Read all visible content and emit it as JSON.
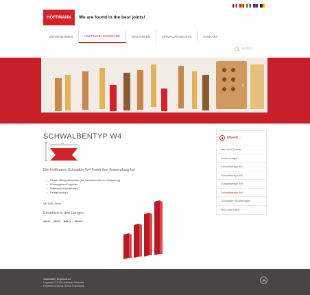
{
  "header": {
    "logo_text": "HOFFMANN",
    "tagline": "We are found in the best joints!",
    "flags": [
      {
        "name": "flag-fr",
        "colors": [
          "#1f3d9a",
          "#ffffff",
          "#d2232a"
        ]
      },
      {
        "name": "flag-es",
        "colors": [
          "#c8102e",
          "#f2c200",
          "#c8102e"
        ]
      },
      {
        "name": "flag-it",
        "colors": [
          "#1e8a3a",
          "#ffffff",
          "#d2232a"
        ]
      },
      {
        "name": "flag-gb",
        "colors": [
          "#1f3d9a",
          "#d2232a",
          "#1f3d9a"
        ]
      },
      {
        "name": "flag-de",
        "colors": [
          "#111111",
          "#d2232a",
          "#f2c200"
        ]
      }
    ]
  },
  "nav": {
    "items": [
      {
        "label": "UNTERNEHMEN",
        "active": false
      },
      {
        "label": "HOFFMANN SCHWALBE",
        "active": true
      },
      {
        "label": "MASCHINEN",
        "active": false
      },
      {
        "label": "SPEZIALPRODUKTE",
        "active": false
      },
      {
        "label": "KONTAKT",
        "active": false
      }
    ]
  },
  "search": {
    "placeholder": "Suchen"
  },
  "content": {
    "title": "SCHWALBENTYP W4",
    "dim_label": "20",
    "intro": "Die Hoffmann-Schwalbe-W4 findet ihre Anwendung bei",
    "bullets": [
      "Pfosten/Riegelfassaden (mit bauaufsichtlicher Zulassung)",
      "Wintergärten/Pergolen",
      "Rahmenkonstruktionen",
      "Fertighausbau"
    ],
    "vpack": "VE 1000 Stück",
    "available": "Erhältlich in den Längen",
    "lengths": [
      "40LO",
      "60LO",
      "90LO",
      "100LO"
    ]
  },
  "sidebar": {
    "header": "MEHR ...",
    "items": [
      {
        "label": "Idee und System",
        "active": false
      },
      {
        "label": "Anwendungen",
        "active": false
      },
      {
        "label": "Schwalbentyp W1",
        "active": false
      },
      {
        "label": "Schwalbentyp W2",
        "active": false
      },
      {
        "label": "Schwalbentyp W3",
        "active": false
      },
      {
        "label": "Schwalbentyp W4",
        "active": true
      },
      {
        "label": "Schwalben Sondertypen",
        "active": false
      },
      {
        "label": "Holz oder Holz?",
        "active": false
      }
    ]
  },
  "footer": {
    "links": "Startseite  |  Impressum",
    "copyright": "Copyright © 2015 Hoffmann Schwalbe",
    "powered": "Powered by Nexus Theme Framework"
  },
  "colors": {
    "brand": "#d2232a",
    "footer": "#4a4444"
  }
}
